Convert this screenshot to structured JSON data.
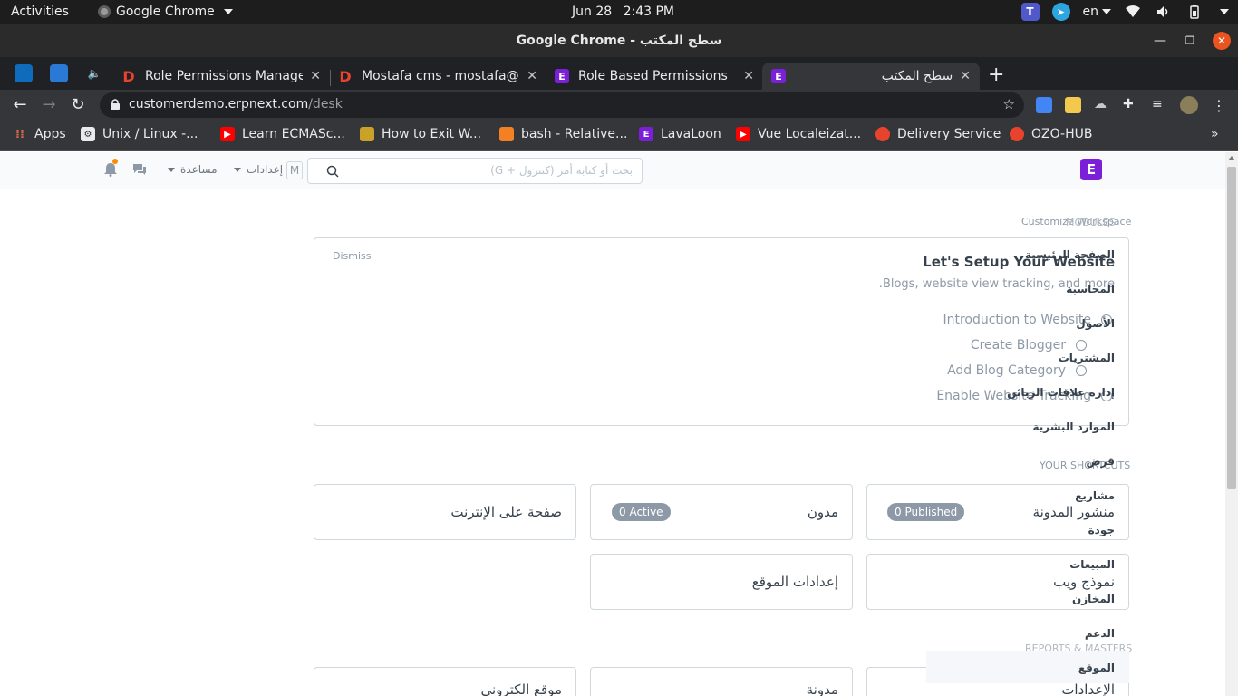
{
  "system": {
    "activities": "Activities",
    "app_name": "Google Chrome",
    "date": "Jun 28",
    "time": "2:43 PM",
    "language": "en"
  },
  "window": {
    "title": "Google Chrome - سطح المكتب"
  },
  "tabs": [
    {
      "label": "Role Permissions Manager",
      "favicon": "D",
      "color": "#e8442d"
    },
    {
      "label": "Mostafa cms - mostafa@e",
      "favicon": "D",
      "color": "#e8442d"
    },
    {
      "label": "Role Based Permissions",
      "favicon": "E",
      "color": "#7c1fd8"
    },
    {
      "label": "سطح المكتب",
      "favicon": "E",
      "color": "#7c1fd8"
    }
  ],
  "omnibox": {
    "host": "customerdemo.erpnext.com",
    "path": "/desk"
  },
  "bookmarks": [
    {
      "label": "Apps",
      "icon": "apps-grid-icon"
    },
    {
      "label": "Unix / Linux -...",
      "icon": "linux-icon"
    },
    {
      "label": "Learn ECMASc...",
      "icon": "youtube-icon"
    },
    {
      "label": "How to Exit W...",
      "icon": "cube-icon"
    },
    {
      "label": "bash - Relative...",
      "icon": "stackoverflow-icon"
    },
    {
      "label": "LavaLoon",
      "icon": "erpnext-icon"
    },
    {
      "label": "Vue Localeizat...",
      "icon": "youtube-icon"
    },
    {
      "label": "Delivery Service",
      "icon": "ozo-icon"
    },
    {
      "label": "OZO-HUB",
      "icon": "ozo-icon"
    }
  ],
  "navbar": {
    "logo": "E",
    "search_placeholder": "بحث أو كتابة أمر (كنترول + G)",
    "shortcut_key": "M",
    "settings": "إعدادات",
    "help": "مساعدة"
  },
  "desk": {
    "customize": "Customize Workspace",
    "modules_heading": "MODULES",
    "setup_card": {
      "dismiss": "Dismiss",
      "title": "Let's Setup Your Website",
      "subtitle": "Blogs, website view tracking, and more.",
      "steps": [
        "Introduction to Website",
        "Create Blogger",
        "Add Blog Category",
        "Enable Website Tracking"
      ]
    },
    "shortcuts_heading": "YOUR SHORTCUTS",
    "reports_heading": "REPORTS & MASTERS",
    "sidebar": [
      "الصفحة الرئيسية",
      "المحاسبة",
      "الأصول",
      "المشتريات",
      "إدارة علاقات الزبائن",
      "الموارد البشرية",
      "قرض",
      "مشاريع",
      "جودة",
      "المبيعات",
      "المخازن",
      "الدعم",
      "الموقع"
    ],
    "shortcuts": [
      {
        "name": "صفحة على الإنترنت",
        "badge": ""
      },
      {
        "name": "مدون",
        "badge": "0 Active"
      },
      {
        "name": "منشور المدونة",
        "badge": "0 Published"
      },
      {
        "name": "إعدادات الموقع",
        "badge": ""
      },
      {
        "name": "نموذج ويب",
        "badge": ""
      }
    ],
    "reports": [
      "موقع الكتروني",
      "مدونة",
      "الإعدادات"
    ]
  }
}
